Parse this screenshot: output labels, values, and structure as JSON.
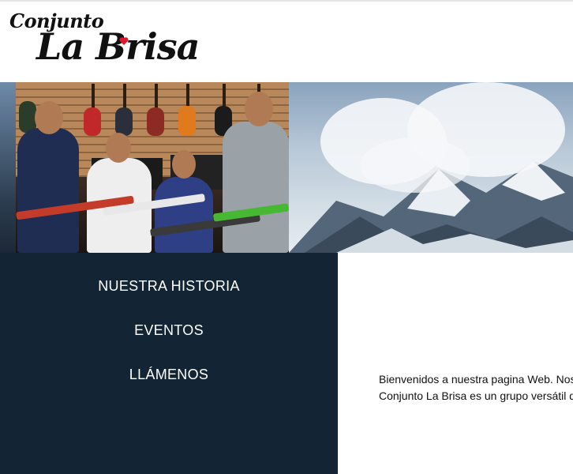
{
  "logo": {
    "line1": "Conjunto",
    "line2": "La Brisa"
  },
  "nav": {
    "items": [
      {
        "label": "NUESTRA HISTORIA"
      },
      {
        "label": "EVENTOS"
      },
      {
        "label": "LLÁMENOS"
      }
    ]
  },
  "welcome": {
    "line1": "Bienvenidos a nuestra pagina Web. Nosot",
    "line2": "Conjunto La Brisa es un grupo versátil qu"
  },
  "colors": {
    "nav_background": "#132435",
    "nav_text": "#ffffff",
    "heart": "#e0182d"
  },
  "icons": {
    "heart": "heart-icon"
  }
}
